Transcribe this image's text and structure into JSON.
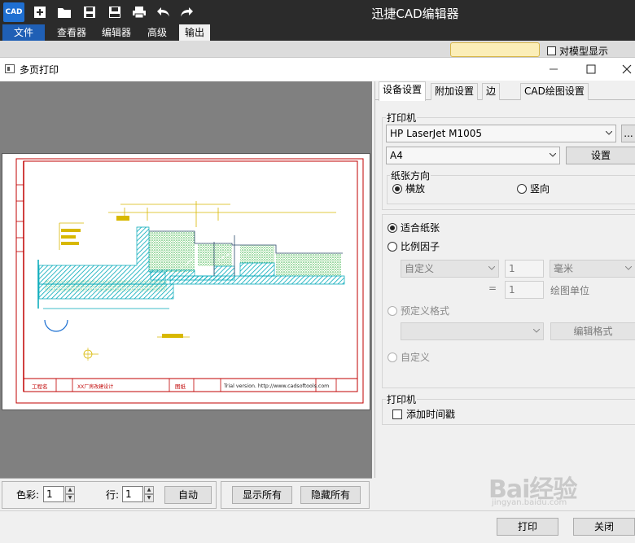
{
  "app": {
    "logo_text": "CAD",
    "title": "迅捷CAD编辑器"
  },
  "menu": {
    "items": [
      {
        "label": "文件"
      },
      {
        "label": "查看器"
      },
      {
        "label": "编辑器"
      },
      {
        "label": "高级"
      },
      {
        "label": "输出"
      }
    ]
  },
  "ribbon": {
    "checkbox_label": "对模型显示"
  },
  "dialog": {
    "title": "多页打印",
    "tabs": [
      {
        "label": "设备设置"
      },
      {
        "label": "附加设置"
      },
      {
        "label": "边"
      },
      {
        "label": "CAD绘图设置"
      }
    ],
    "printer": {
      "group_label": "打印机",
      "printer_name": "HP LaserJet M1005",
      "browse_label": "...",
      "paper_size": "A4",
      "setup_label": "设置"
    },
    "orientation": {
      "group_label": "纸张方向",
      "landscape": "横放",
      "portrait": "竖向",
      "selected": "landscape"
    },
    "scale": {
      "fit_paper": "适合纸张",
      "scale_factor": "比例因子",
      "custom_combo": "自定义",
      "factor_value": "1",
      "unit_combo": "毫米",
      "equals": "=",
      "drawing_value": "1",
      "drawing_units": "绘图单位",
      "predefined_format": "预定义格式",
      "edit_format": "编辑格式",
      "custom": "自定义",
      "selected": "fit_paper"
    },
    "timestamp": {
      "group_label": "打印机",
      "checkbox_label": "添加时间戳",
      "checked": false
    },
    "bottom": {
      "color_label": "色彩:",
      "color_value": "1",
      "row_label": "行:",
      "row_value": "1",
      "auto_label": "自动",
      "show_all_label": "显示所有",
      "hide_all_label": "隐藏所有"
    },
    "actions": {
      "print_label": "打印",
      "close_label": "关闭"
    }
  },
  "drawing": {
    "title_block": [
      "工程名",
      "XX厂房改建设计",
      "图纸"
    ],
    "trial_text": "Trial version. http://www.cadsoftools.com"
  },
  "watermark": {
    "main": "Bai经验",
    "sub": "jingyan.baidu.com"
  },
  "colors": {
    "titlebar": "#2b2b2b",
    "file_menu": "#1f5fb5",
    "drawing_border": "#c00000",
    "hatch_cyan": "#00a8b8",
    "hatch_green": "#3cb34a",
    "annotation_yellow": "#d8b800"
  }
}
